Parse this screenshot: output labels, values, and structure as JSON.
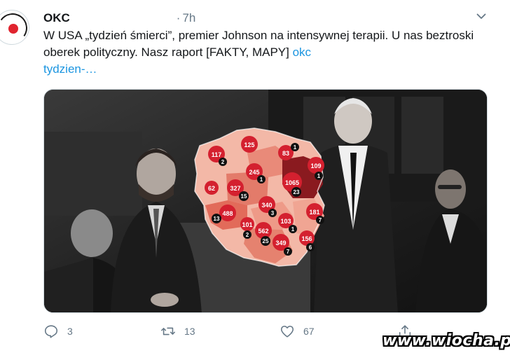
{
  "tweet": {
    "display_name": "OKC",
    "separator": "·",
    "time": "7h",
    "text_part1": "W USA „tydzień śmierci”, premier Johnson na intensywnej terapii. U nas beztroski oberek polityczny. Nasz raport [FAKTY, MAPY] ",
    "link_start": "okc",
    "link_end": "tydzien-…",
    "icons": {
      "more": "chevron-down-icon",
      "reply": "reply-icon",
      "retweet": "retweet-icon",
      "like": "heart-icon",
      "share": "share-icon"
    }
  },
  "map": {
    "regions": [
      {
        "cases": "125",
        "deaths": ""
      },
      {
        "cases": "83",
        "deaths": "1"
      },
      {
        "cases": "117",
        "deaths": "2"
      },
      {
        "cases": "109",
        "deaths": "1"
      },
      {
        "cases": "245",
        "deaths": "1"
      },
      {
        "cases": "1065",
        "deaths": "23"
      },
      {
        "cases": "62",
        "deaths": ""
      },
      {
        "cases": "327",
        "deaths": "15"
      },
      {
        "cases": "488",
        "deaths": "13"
      },
      {
        "cases": "340",
        "deaths": "3"
      },
      {
        "cases": "181",
        "deaths": "7"
      },
      {
        "cases": "101",
        "deaths": "2"
      },
      {
        "cases": "562",
        "deaths": "25"
      },
      {
        "cases": "103",
        "deaths": "1"
      },
      {
        "cases": "156",
        "deaths": "6"
      },
      {
        "cases": "349",
        "deaths": "7"
      }
    ]
  },
  "stats": {
    "replies": "3",
    "retweets": "13",
    "likes": "67"
  },
  "watermark": "www.wiocha.pl",
  "colors": {
    "link": "#1b95e0",
    "secondary": "#657786",
    "bubble": "#d4202f",
    "map_dark": "#7a1015"
  }
}
